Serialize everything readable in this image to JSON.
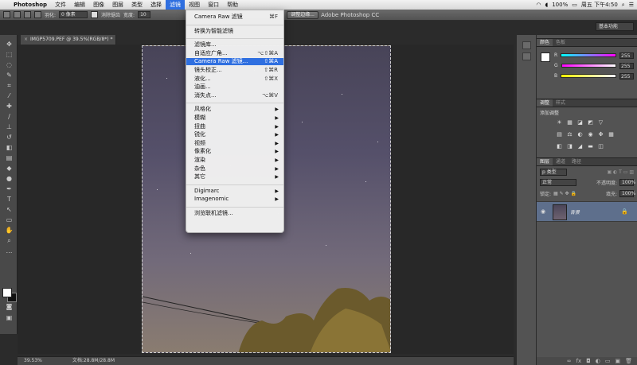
{
  "menubar": {
    "app": "Photoshop",
    "items": [
      "文件",
      "编辑",
      "图像",
      "图层",
      "类型",
      "选择",
      "滤镜",
      "视图",
      "窗口",
      "帮助"
    ],
    "active_index": 6,
    "status": {
      "battery": "100%",
      "datetime": "周五 下午4:50",
      "window_title": "Adobe Photoshop CC"
    }
  },
  "optbar": {
    "feather_label": "羽化:",
    "feather_value": "0 像素",
    "antialias_label": "消除锯齿",
    "style_label": "宽度:",
    "style_value": "10",
    "refine_button": "调整边缘...",
    "workspace": "基本功能"
  },
  "document": {
    "tab_title": "IMGP5709.PEF @ 39.5%(RGB/8*) *",
    "zoom": "39.53%",
    "doc_size": "文档:28.8M/28.8M"
  },
  "filter_menu": {
    "items": [
      {
        "label": "Camera Raw 滤镜",
        "shortcut": "⌘F",
        "type": "item"
      },
      {
        "type": "sep"
      },
      {
        "label": "转换为智能滤镜",
        "shortcut": "",
        "type": "item"
      },
      {
        "type": "sep"
      },
      {
        "label": "滤镜库...",
        "shortcut": "",
        "type": "item"
      },
      {
        "label": "自适应广角...",
        "shortcut": "⌥⇧⌘A",
        "type": "item"
      },
      {
        "label": "Camera Raw 滤镜...",
        "shortcut": "⇧⌘A",
        "type": "item",
        "highlight": true
      },
      {
        "label": "镜头校正...",
        "shortcut": "⇧⌘R",
        "type": "item"
      },
      {
        "label": "液化...",
        "shortcut": "⇧⌘X",
        "type": "item"
      },
      {
        "label": "油画...",
        "shortcut": "",
        "type": "item"
      },
      {
        "label": "消失点...",
        "shortcut": "⌥⌘V",
        "type": "item"
      },
      {
        "type": "sep"
      },
      {
        "label": "风格化",
        "shortcut": "",
        "type": "sub"
      },
      {
        "label": "模糊",
        "shortcut": "",
        "type": "sub"
      },
      {
        "label": "扭曲",
        "shortcut": "",
        "type": "sub"
      },
      {
        "label": "锐化",
        "shortcut": "",
        "type": "sub"
      },
      {
        "label": "视频",
        "shortcut": "",
        "type": "sub"
      },
      {
        "label": "像素化",
        "shortcut": "",
        "type": "sub"
      },
      {
        "label": "渲染",
        "shortcut": "",
        "type": "sub"
      },
      {
        "label": "杂色",
        "shortcut": "",
        "type": "sub"
      },
      {
        "label": "其它",
        "shortcut": "",
        "type": "sub"
      },
      {
        "type": "sep"
      },
      {
        "label": "Digimarc",
        "shortcut": "",
        "type": "sub"
      },
      {
        "label": "Imagenomic",
        "shortcut": "",
        "type": "sub"
      },
      {
        "type": "sep"
      },
      {
        "label": "浏览联机滤镜...",
        "shortcut": "",
        "type": "item"
      }
    ]
  },
  "color_panel": {
    "tabs": [
      "颜色",
      "色板"
    ],
    "sliders": [
      {
        "ch": "R",
        "value": "255",
        "color": "#e23c3c"
      },
      {
        "ch": "G",
        "value": "255",
        "color": "#3cc83c"
      },
      {
        "ch": "B",
        "value": "255",
        "color": "#3c5ae2"
      }
    ]
  },
  "adjust_panel": {
    "tabs": [
      "调整",
      "样式"
    ],
    "title": "添加调整"
  },
  "layers_panel": {
    "tabs": [
      "图层",
      "通道",
      "路径"
    ],
    "kind": "p 类型",
    "blend": "正常",
    "opacity_label": "不透明度:",
    "opacity_value": "100%",
    "lock_label": "锁定:",
    "fill_label": "填充:",
    "fill_value": "100%",
    "layer_name": "背景"
  },
  "colors": {
    "accent": "#2f6fe0"
  }
}
